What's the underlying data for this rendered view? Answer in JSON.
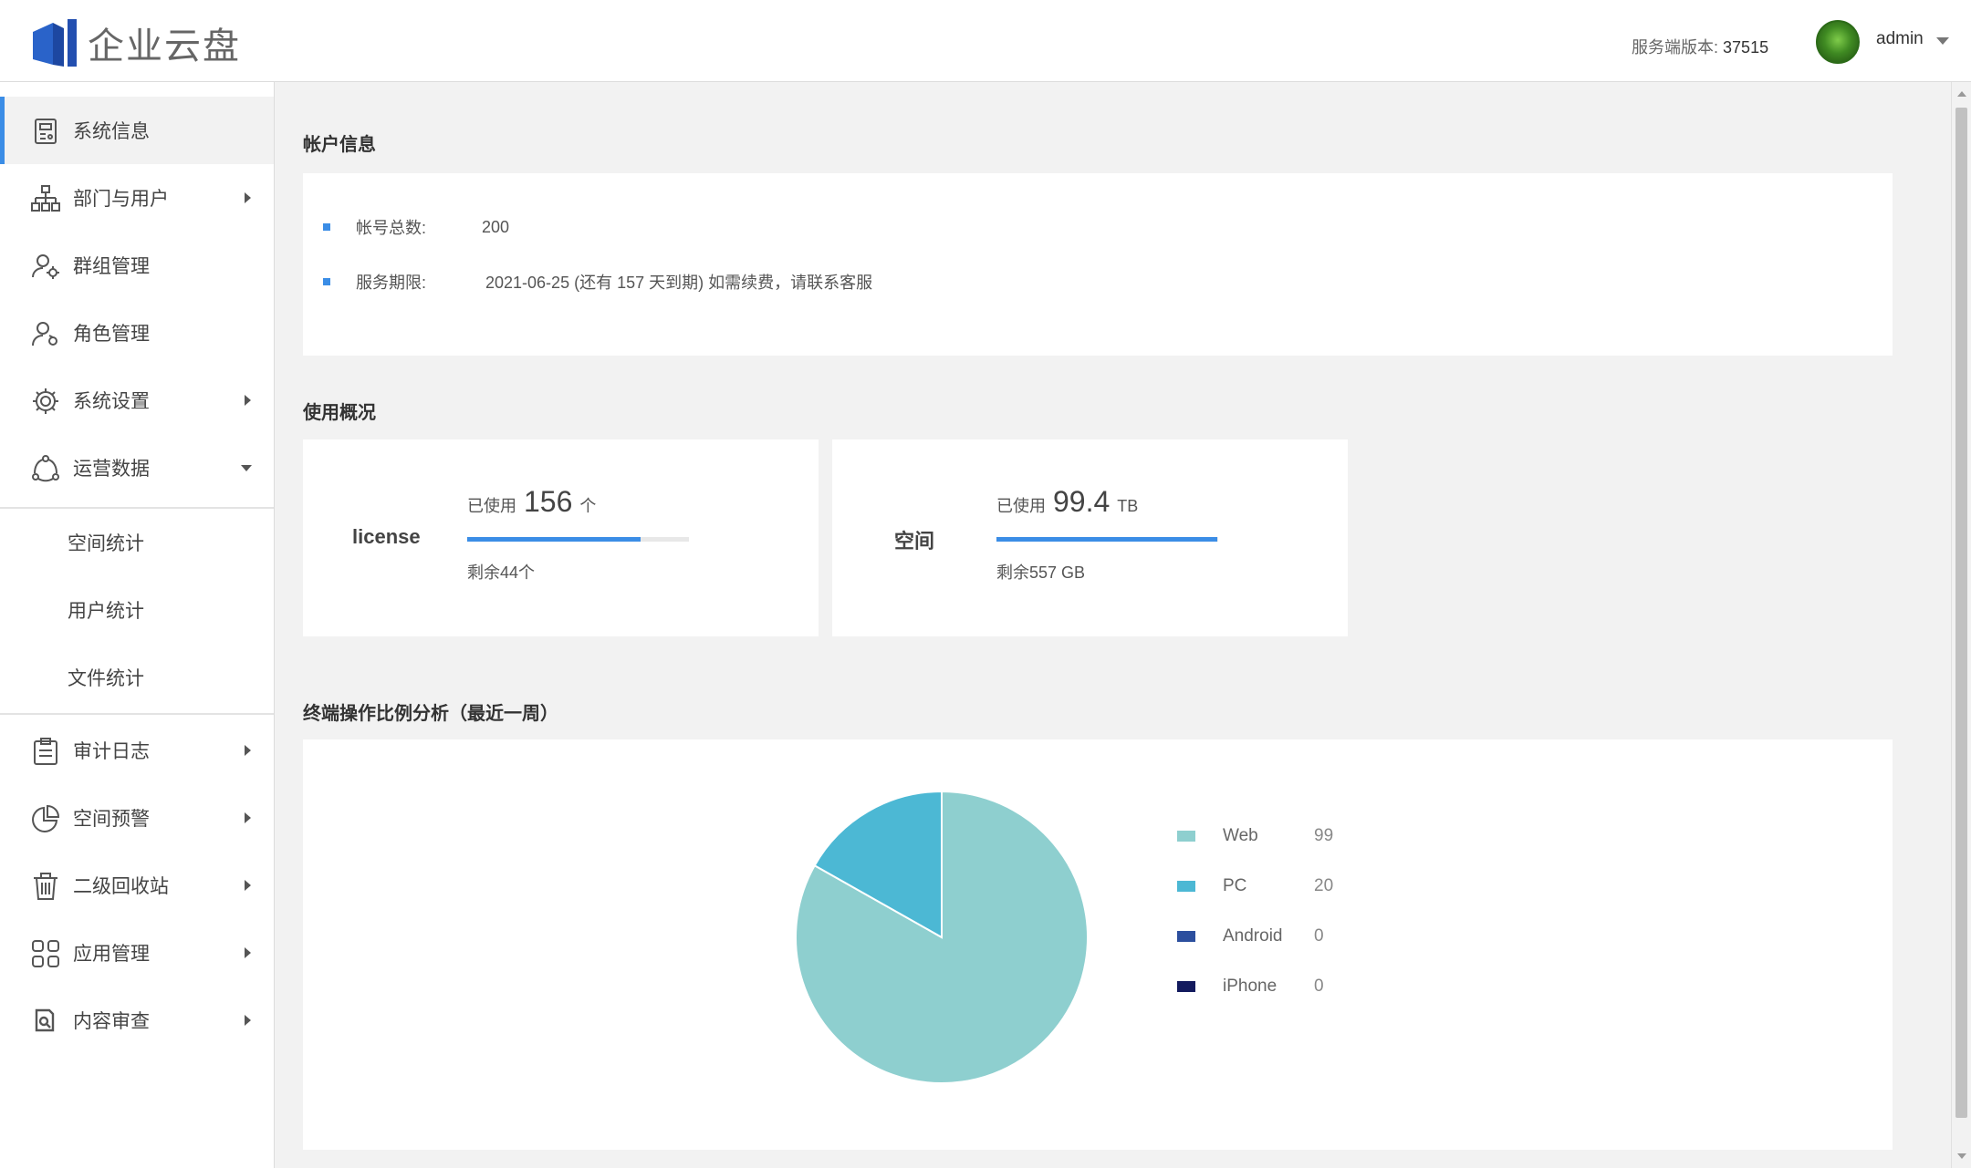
{
  "header": {
    "brand": "企业云盘",
    "version_label": "服务端版本:",
    "version_number": "37515",
    "username": "admin"
  },
  "sidebar": {
    "items": [
      {
        "label": "系统信息",
        "icon": "server-info-icon",
        "active": true
      },
      {
        "label": "部门与用户",
        "icon": "org-chart-icon",
        "expandable": true
      },
      {
        "label": "群组管理",
        "icon": "group-settings-icon"
      },
      {
        "label": "角色管理",
        "icon": "user-role-icon"
      },
      {
        "label": "系统设置",
        "icon": "gear-icon",
        "expandable": true
      },
      {
        "label": "运营数据",
        "icon": "operations-icon",
        "expanded": true
      },
      {
        "label": "审计日志",
        "icon": "clipboard-icon",
        "expandable": true
      },
      {
        "label": "空间预警",
        "icon": "pie-clock-icon",
        "expandable": true
      },
      {
        "label": "二级回收站",
        "icon": "trash-icon",
        "expandable": true
      },
      {
        "label": "应用管理",
        "icon": "apps-grid-icon",
        "expandable": true
      },
      {
        "label": "内容审查",
        "icon": "document-search-icon",
        "expandable": true
      }
    ],
    "sub_items": [
      "空间统计",
      "用户统计",
      "文件统计"
    ]
  },
  "account": {
    "title": "帐户信息",
    "rows": [
      {
        "key": "帐号总数:",
        "value": "200"
      },
      {
        "key": "服务期限:",
        "value": "2021-06-25 (还有 157 天到期) 如需续费，请联系客服"
      }
    ]
  },
  "usage": {
    "title": "使用概况",
    "license": {
      "label": "license",
      "used_prefix": "已使用",
      "used_value": "156",
      "unit": "个",
      "remaining": "剩余44个",
      "fill_fraction": 0.78
    },
    "space": {
      "label": "空间",
      "used_prefix": "已使用",
      "used_value": "99.4",
      "unit": "TB",
      "remaining": "剩余557 GB",
      "fill_fraction": 0.994
    },
    "bar_color": "#3b8de6"
  },
  "chart_section": {
    "title": "终端操作比例分析（最近一周）"
  },
  "chart_data": {
    "type": "pie",
    "categories": [
      "Web",
      "PC",
      "Android",
      "iPhone"
    ],
    "values": [
      99,
      20,
      0,
      0
    ],
    "colors": [
      "#8ecfcf",
      "#4cb8d4",
      "#2c4f9e",
      "#131a5e"
    ],
    "legend_position": "right"
  }
}
